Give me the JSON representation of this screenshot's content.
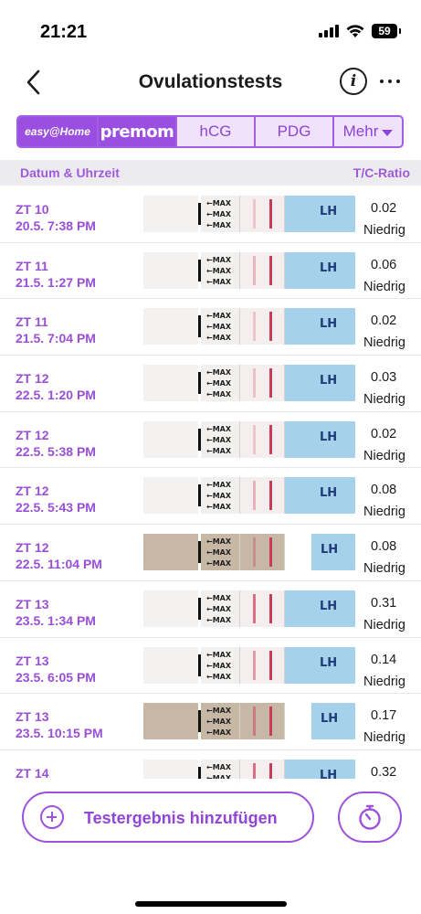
{
  "status_bar": {
    "time": "21:21",
    "battery": "59"
  },
  "nav": {
    "title": "Ovulationstests",
    "info_icon": "i"
  },
  "brand_tabs": [
    {
      "label": "easy@Home"
    },
    {
      "label": "premom"
    },
    {
      "label": "hCG"
    },
    {
      "label": "PDG"
    },
    {
      "label": "Mehr"
    }
  ],
  "list_header": {
    "left": "Datum & Uhrzeit",
    "right": "T/C-Ratio"
  },
  "strip_text": {
    "max": "←MAX",
    "brand": "easy@home",
    "lh": "LH"
  },
  "tests": [
    {
      "day": "ZT 10",
      "datetime": "20.5. 7:38 PM",
      "ratio": "0.02",
      "level": "Niedrig",
      "strip": "white",
      "test_line_intensity": 0.05
    },
    {
      "day": "ZT 11",
      "datetime": "21.5. 1:27 PM",
      "ratio": "0.06",
      "level": "Niedrig",
      "strip": "white",
      "test_line_intensity": 0.1
    },
    {
      "day": "ZT 11",
      "datetime": "21.5. 7:04 PM",
      "ratio": "0.02",
      "level": "Niedrig",
      "strip": "white",
      "test_line_intensity": 0.05
    },
    {
      "day": "ZT 12",
      "datetime": "22.5. 1:20 PM",
      "ratio": "0.03",
      "level": "Niedrig",
      "strip": "white",
      "test_line_intensity": 0.06
    },
    {
      "day": "ZT 12",
      "datetime": "22.5. 5:38 PM",
      "ratio": "0.02",
      "level": "Niedrig",
      "strip": "white",
      "test_line_intensity": 0.05
    },
    {
      "day": "ZT 12",
      "datetime": "22.5. 5:43 PM",
      "ratio": "0.08",
      "level": "Niedrig",
      "strip": "white",
      "test_line_intensity": 0.12
    },
    {
      "day": "ZT 12",
      "datetime": "22.5. 11:04 PM",
      "ratio": "0.08",
      "level": "Niedrig",
      "strip": "tan",
      "test_line_intensity": 0.12
    },
    {
      "day": "ZT 13",
      "datetime": "23.5. 1:34 PM",
      "ratio": "0.31",
      "level": "Niedrig",
      "strip": "white",
      "test_line_intensity": 0.35
    },
    {
      "day": "ZT 13",
      "datetime": "23.5. 6:05 PM",
      "ratio": "0.14",
      "level": "Niedrig",
      "strip": "white",
      "test_line_intensity": 0.2
    },
    {
      "day": "ZT 13",
      "datetime": "23.5. 10:15 PM",
      "ratio": "0.17",
      "level": "Niedrig",
      "strip": "tan",
      "test_line_intensity": 0.22
    },
    {
      "day": "ZT 14",
      "datetime": "",
      "ratio": "0.32",
      "level": "",
      "strip": "white",
      "test_line_intensity": 0.35
    }
  ],
  "actions": {
    "add_result": "Testergebnis hinzufügen"
  },
  "colors": {
    "accent": "#9d52dc",
    "control_line": "#cc3b58",
    "strip_blue": "#a5d2ea"
  }
}
